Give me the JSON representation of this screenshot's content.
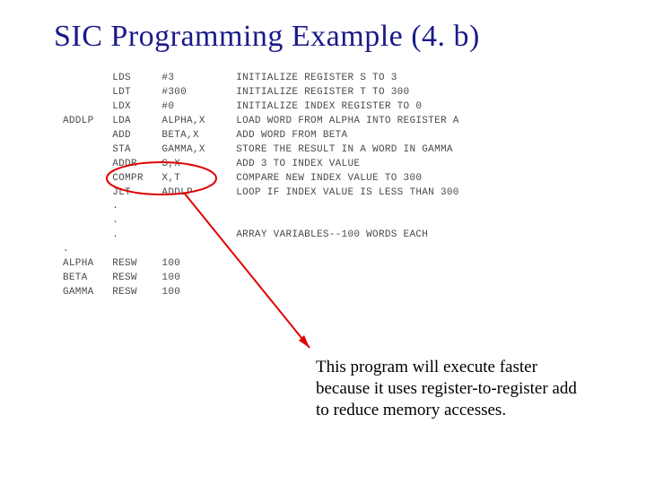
{
  "title": "SIC Programming Example (4. b)",
  "code": {
    "lines": [
      {
        "label": "",
        "op": "LDS",
        "operand": "#3",
        "comment": "INITIALIZE REGISTER S TO 3"
      },
      {
        "label": "",
        "op": "LDT",
        "operand": "#300",
        "comment": "INITIALIZE REGISTER T TO 300"
      },
      {
        "label": "",
        "op": "LDX",
        "operand": "#0",
        "comment": "INITIALIZE INDEX REGISTER TO 0"
      },
      {
        "label": "ADDLP",
        "op": "LDA",
        "operand": "ALPHA,X",
        "comment": "LOAD WORD FROM ALPHA INTO REGISTER A"
      },
      {
        "label": "",
        "op": "ADD",
        "operand": "BETA,X",
        "comment": "ADD WORD FROM BETA"
      },
      {
        "label": "",
        "op": "STA",
        "operand": "GAMMA,X",
        "comment": "STORE THE RESULT IN A WORD IN GAMMA"
      },
      {
        "label": "",
        "op": "ADDR",
        "operand": "S,X",
        "comment": "ADD 3 TO INDEX VALUE"
      },
      {
        "label": "",
        "op": "COMPR",
        "operand": "X,T",
        "comment": "COMPARE NEW INDEX VALUE TO 300"
      },
      {
        "label": "",
        "op": "JLT",
        "operand": "ADDLP",
        "comment": "LOOP IF INDEX VALUE IS LESS THAN 300"
      },
      {
        "label": "",
        "op": ".",
        "operand": "",
        "comment": ""
      },
      {
        "label": "",
        "op": ".",
        "operand": "",
        "comment": ""
      },
      {
        "label": "",
        "op": ".",
        "operand": "",
        "comment": "ARRAY VARIABLES--100 WORDS EACH"
      },
      {
        "label": ".",
        "op": "",
        "operand": "",
        "comment": ""
      },
      {
        "label": "ALPHA",
        "op": "RESW",
        "operand": "100",
        "comment": ""
      },
      {
        "label": "BETA",
        "op": "RESW",
        "operand": "100",
        "comment": ""
      },
      {
        "label": "GAMMA",
        "op": "RESW",
        "operand": "100",
        "comment": ""
      }
    ]
  },
  "caption": "This program will execute faster because it uses register-to-register add to reduce memory accesses."
}
